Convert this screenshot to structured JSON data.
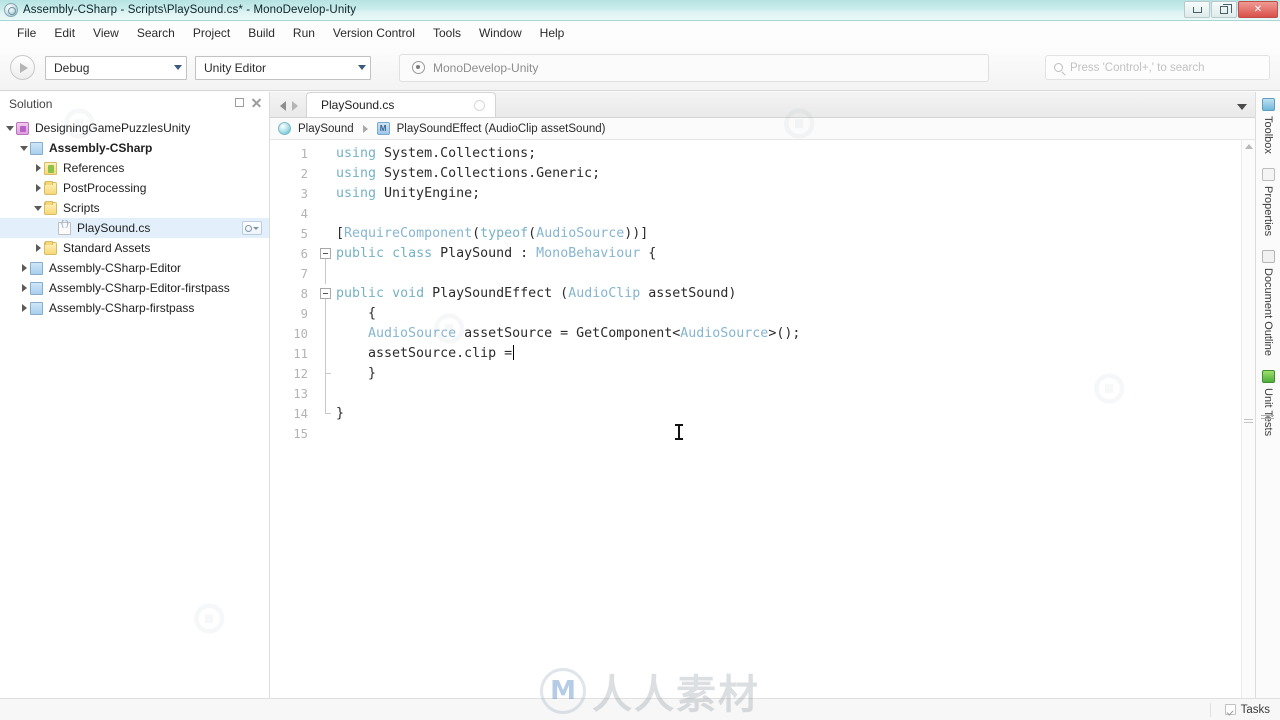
{
  "window": {
    "title": "Assembly-CSharp - Scripts\\PlaySound.cs* - MonoDevelop-Unity",
    "app_icon": "monodevelop-icon",
    "minimize": "minimize-button",
    "maximize": "restore-button",
    "close": "close-button"
  },
  "menubar": {
    "items": [
      {
        "label": "File"
      },
      {
        "label": "Edit"
      },
      {
        "label": "View"
      },
      {
        "label": "Search"
      },
      {
        "label": "Project"
      },
      {
        "label": "Build"
      },
      {
        "label": "Run"
      },
      {
        "label": "Version Control"
      },
      {
        "label": "Tools"
      },
      {
        "label": "Window"
      },
      {
        "label": "Help"
      }
    ]
  },
  "toolbar": {
    "run_button": "run-button",
    "configuration": "Debug",
    "runtime_target": "Unity Editor",
    "solution_status": "MonoDevelop-Unity",
    "search_placeholder": "Press 'Control+,' to search"
  },
  "solution_pad": {
    "title": "Solution",
    "pin_label": "pin-pad-button",
    "close_label": "close-pad-button",
    "tree": [
      {
        "label": "DesigningGamePuzzlesUnity",
        "indent": 0,
        "twisty": "down",
        "icon": "solution-icon",
        "bold": false,
        "selected": false,
        "gear": false
      },
      {
        "label": "Assembly-CSharp",
        "indent": 1,
        "twisty": "down",
        "icon": "project-icon",
        "bold": true,
        "selected": false,
        "gear": false
      },
      {
        "label": "References",
        "indent": 2,
        "twisty": "right",
        "icon": "references-icon",
        "bold": false,
        "selected": false,
        "gear": false
      },
      {
        "label": "PostProcessing",
        "indent": 2,
        "twisty": "right",
        "icon": "folder-icon",
        "bold": false,
        "selected": false,
        "gear": false
      },
      {
        "label": "Scripts",
        "indent": 2,
        "twisty": "down",
        "icon": "folder-icon",
        "bold": false,
        "selected": false,
        "gear": false
      },
      {
        "label": "PlaySound.cs",
        "indent": 3,
        "twisty": "none",
        "icon": "csharp-file-icon",
        "bold": false,
        "selected": true,
        "gear": true
      },
      {
        "label": "Standard Assets",
        "indent": 2,
        "twisty": "right",
        "icon": "folder-icon",
        "bold": false,
        "selected": false,
        "gear": false
      },
      {
        "label": "Assembly-CSharp-Editor",
        "indent": 1,
        "twisty": "right",
        "icon": "project-icon",
        "bold": false,
        "selected": false,
        "gear": false
      },
      {
        "label": "Assembly-CSharp-Editor-firstpass",
        "indent": 1,
        "twisty": "right",
        "icon": "project-icon",
        "bold": false,
        "selected": false,
        "gear": false
      },
      {
        "label": "Assembly-CSharp-firstpass",
        "indent": 1,
        "twisty": "right",
        "icon": "project-icon",
        "bold": false,
        "selected": false,
        "gear": false
      }
    ]
  },
  "editor": {
    "tab": {
      "label": "PlaySound.cs",
      "close": "close-tab-button"
    },
    "tab_nav_prev": "previous-tab-button",
    "tab_nav_next": "next-tab-button",
    "tab_list_dropdown": "tab-list-dropdown",
    "breadcrumb": {
      "class": "PlaySound",
      "member": "PlaySoundEffect (AudioClip assetSound)",
      "class_icon": "class-icon",
      "member_icon": "method-icon"
    },
    "lines": [
      {
        "n": "1",
        "fold": "none",
        "tokens": [
          {
            "t": "using",
            "c": "kw"
          },
          {
            "t": " System.Collections;",
            "c": "pln"
          }
        ]
      },
      {
        "n": "2",
        "fold": "none",
        "tokens": [
          {
            "t": "using",
            "c": "kw"
          },
          {
            "t": " System.Collections.Generic;",
            "c": "pln"
          }
        ]
      },
      {
        "n": "3",
        "fold": "none",
        "tokens": [
          {
            "t": "using",
            "c": "kw"
          },
          {
            "t": " UnityEngine;",
            "c": "pln"
          }
        ]
      },
      {
        "n": "4",
        "fold": "none",
        "tokens": []
      },
      {
        "n": "5",
        "fold": "none",
        "tokens": [
          {
            "t": "[",
            "c": "pln"
          },
          {
            "t": "RequireComponent",
            "c": "typ"
          },
          {
            "t": "(",
            "c": "pln"
          },
          {
            "t": "typeof",
            "c": "kw"
          },
          {
            "t": "(",
            "c": "pln"
          },
          {
            "t": "AudioSource",
            "c": "typ"
          },
          {
            "t": "))]",
            "c": "pln"
          }
        ]
      },
      {
        "n": "6",
        "fold": "box",
        "tokens": [
          {
            "t": "public",
            "c": "kw"
          },
          {
            "t": " ",
            "c": "pln"
          },
          {
            "t": "class",
            "c": "kw"
          },
          {
            "t": " PlaySound : ",
            "c": "pln"
          },
          {
            "t": "MonoBehaviour",
            "c": "typ"
          },
          {
            "t": " {",
            "c": "pln"
          }
        ]
      },
      {
        "n": "7",
        "fold": "line",
        "tokens": []
      },
      {
        "n": "8",
        "fold": "box",
        "tokens": [
          {
            "t": "public",
            "c": "kw"
          },
          {
            "t": " ",
            "c": "pln"
          },
          {
            "t": "void",
            "c": "kw"
          },
          {
            "t": " PlaySoundEffect (",
            "c": "pln"
          },
          {
            "t": "AudioClip",
            "c": "typ"
          },
          {
            "t": " assetSound)",
            "c": "pln"
          }
        ]
      },
      {
        "n": "9",
        "fold": "line",
        "tokens": [
          {
            "t": "    {",
            "c": "pln"
          }
        ]
      },
      {
        "n": "10",
        "fold": "line",
        "tokens": [
          {
            "t": "    ",
            "c": "pln"
          },
          {
            "t": "AudioSource",
            "c": "typ"
          },
          {
            "t": " assetSource = GetComponent<",
            "c": "pln"
          },
          {
            "t": "AudioSource",
            "c": "typ"
          },
          {
            "t": ">();",
            "c": "pln"
          }
        ]
      },
      {
        "n": "11",
        "fold": "line",
        "tokens": [
          {
            "t": "    assetSource.clip =",
            "c": "pln"
          }
        ],
        "caret": true
      },
      {
        "n": "12",
        "fold": "tick",
        "tokens": [
          {
            "t": "    }",
            "c": "pln"
          }
        ]
      },
      {
        "n": "13",
        "fold": "line",
        "tokens": []
      },
      {
        "n": "14",
        "fold": "end",
        "tokens": [
          {
            "t": "}",
            "c": "pln"
          }
        ]
      },
      {
        "n": "15",
        "fold": "none",
        "tokens": []
      }
    ]
  },
  "right_pads": {
    "items": [
      {
        "label": "Toolbox",
        "icon": "toolbox-icon"
      },
      {
        "label": "Properties",
        "icon": "properties-icon"
      },
      {
        "label": "Document Outline",
        "icon": "document-outline-icon"
      },
      {
        "label": "Unit Tests",
        "icon": "unit-tests-icon"
      }
    ]
  },
  "statusbar": {
    "tasks_label": "Tasks",
    "tasks_checked": true
  },
  "colors": {
    "titlebar": "#c9eceb",
    "accent_selection": "#e3f0fb",
    "keyword": "#75b2c4",
    "type": "#86b5d1",
    "plain": "#2b2b2b",
    "close_button": "#d9504a"
  },
  "watermark": {
    "logo_letter": "M",
    "text": "人人素材"
  }
}
